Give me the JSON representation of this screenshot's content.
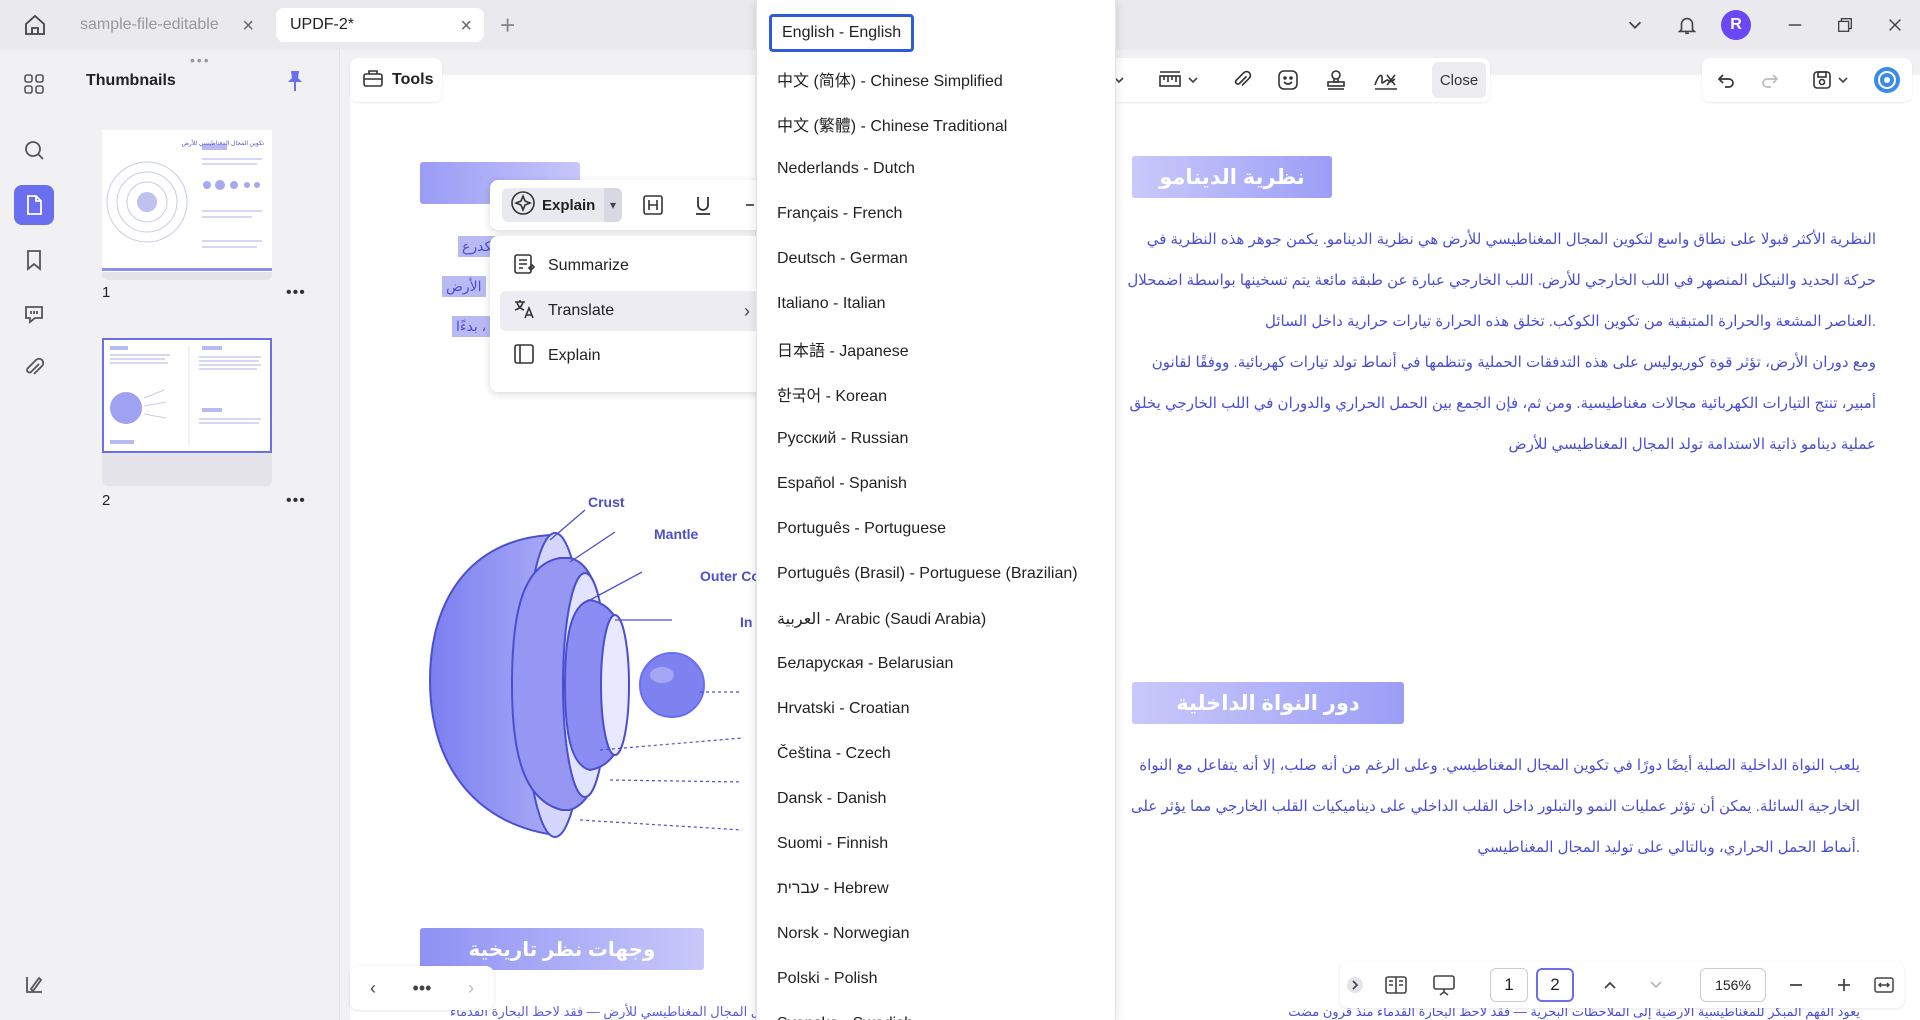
{
  "tabs": [
    {
      "label": "sample-file-editable",
      "active": false
    },
    {
      "label": "UPDF-2*",
      "active": true
    }
  ],
  "header": {
    "avatar_initial": "R"
  },
  "sidebar": {
    "title": "Thumbnails"
  },
  "thumbnails": [
    {
      "page": "1",
      "title_ar": "تكوين المجال المغناطيسي للأرض"
    },
    {
      "page": "2"
    }
  ],
  "toolbar": {
    "tools_label": "Tools",
    "close_label": "Close"
  },
  "floating_toolbar": {
    "explain_label": "Explain"
  },
  "context_menu": {
    "items": [
      {
        "label": "Summarize",
        "icon": "summarize-icon"
      },
      {
        "label": "Translate",
        "icon": "translate-icon",
        "has_submenu": true
      },
      {
        "label": "Explain",
        "icon": "explain-icon"
      }
    ]
  },
  "left_page": {
    "selected_fragments": [
      "تكدرع",
      "الأرض",
      "بدءًا ،"
    ],
    "diagram_labels": [
      "Crust",
      "Mantle",
      "Outer Co",
      "In"
    ],
    "bottom_heading": "وجهات نظر تاريخية",
    "bottom_text": "وجهات نظر تاريخية حول المجال المغناطيسي للأرض — فقد لاحظ البحارة القدماء"
  },
  "right_page": {
    "section1": {
      "heading": "نظرية الدينامو",
      "lines": [
        "النظرية الأكثر قبولا على نطاق واسع لتكوين المجال المغناطيسي للأرض هي نظرية الدينامو. يكمن جوهر هذه النظرية في",
        "حركة الحديد والنيكل المنصهر في اللب الخارجي للأرض. اللب الخارجي عبارة عن طبقة مائعة يتم تسخينها بواسطة اضمحلال",
        ".العناصر المشعة والحرارة المتبقية من تكوين الكوكب. تخلق هذه الحرارة تيارات حرارية داخل السائل",
        "ومع دوران الأرض، تؤثر قوة كوريوليس على هذه التدفقات الحملية وتنظمها في أنماط تولد تيارات كهربائية. ووفقًا لقانون",
        "أمبير، تنتج التيارات الكهربائية مجالات مغناطيسية. ومن ثم، فإن الجمع بين الحمل الحراري والدوران في اللب الخارجي يخلق",
        "عملية دينامو ذاتية الاستدامة تولد المجال المغناطيسي للأرض"
      ]
    },
    "section2": {
      "heading": "دور النواة الداخلية",
      "lines": [
        "يلعب النواة الداخلية الصلبة أيضًا دورًا في تكوين المجال المغناطيسي. وعلى الرغم من أنه صلب، إلا أنه يتفاعل مع النواة",
        "الخارجية السائلة. يمكن أن تؤثر عمليات النمو والتبلور داخل القلب الداخلي على ديناميكيات القلب الخارجي مما يؤثر على",
        ".أنماط الحمل الحراري، وبالتالي على توليد المجال المغناطيسي"
      ]
    },
    "bottom_text": "يعود الفهم المبكر للمغناطيسية الأرضية إلى الملاحظات البحرية — فقد لاحظ البحارة القدماء منذ قرون مضت"
  },
  "language_menu": {
    "selected": "English - English",
    "items": [
      "English - English",
      "中文 (简体) - Chinese Simplified",
      "中文 (繁體) - Chinese Traditional",
      "Nederlands - Dutch",
      "Français - French",
      "Deutsch - German",
      "Italiano - Italian",
      "日本語 - Japanese",
      "한국어 - Korean",
      "Русский - Russian",
      "Español - Spanish",
      "Português - Portuguese",
      "Português (Brasil) - Portuguese (Brazilian)",
      "العربية - Arabic (Saudi Arabia)",
      "Беларуская - Belarusian",
      "Hrvatski - Croatian",
      "Čeština - Czech",
      "Dansk - Danish",
      "Suomi - Finnish",
      "עברית - Hebrew",
      "Norsk - Norwegian",
      "Polski - Polish",
      "Svenska - Swedish"
    ]
  },
  "page_nav": {
    "page_1": "1",
    "page_2": "2",
    "current_page": "2",
    "zoom": "156%"
  },
  "colors": {
    "accent": "#6a6ff0",
    "text_purple": "#4b4fcf",
    "selected_border": "#2f5bd8"
  }
}
